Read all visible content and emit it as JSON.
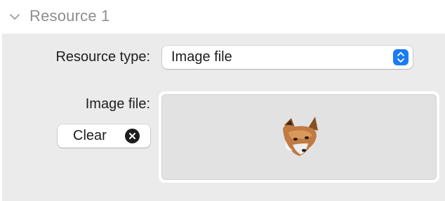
{
  "section": {
    "title": "Resource 1",
    "expanded": true,
    "chevron_icon": "chevron-down-icon"
  },
  "form": {
    "resource_type_label": "Resource type:",
    "resource_type_value": "Image file",
    "image_file_label": "Image file:",
    "clear_label": "Clear"
  },
  "image": {
    "subject": "fox-head-image"
  },
  "colors": {
    "accent": "#1a7cf5",
    "panel_bg": "#ebebeb",
    "well_bg": "#e2e2e2"
  }
}
